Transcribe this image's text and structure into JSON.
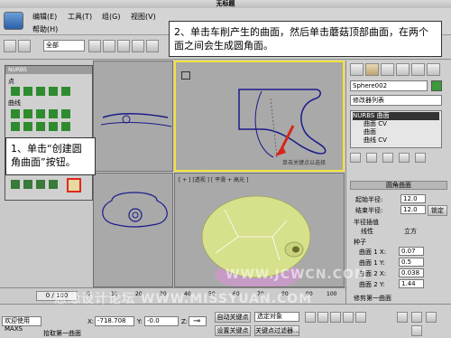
{
  "app": {
    "title": "无标题"
  },
  "menu": [
    "编辑(E)",
    "工具(T)",
    "组(G)",
    "视图(V)",
    "帮助(H)"
  ],
  "toolbar": {
    "selection_filter": "全部"
  },
  "callouts": {
    "step1": "1、单击“创建圆角曲面”按钮。",
    "step2": "2、单击车削产生的曲面，然后单击蘑菇顶部曲面，在两个面之间会生成圆角面。"
  },
  "nurbs_panel": {
    "title": "NURBS",
    "section_point": "点",
    "section_curve": "曲线"
  },
  "viewports": {
    "top_right_label": "",
    "bottom_right_label": "[ + ] [透视 ] [ 平滑 + 高光 ]",
    "hint": "单击关键点以选择"
  },
  "command_panel": {
    "object_name": "Sphere002",
    "modifier_list": "修改器列表",
    "stack": [
      "NURBS 曲面",
      "曲面 CV",
      "曲面",
      "曲线 CV"
    ],
    "rollout_title": "圆角曲面",
    "start_radius_label": "起始半径:",
    "start_radius": "12.0",
    "end_radius_label": "结束半径:",
    "end_radius": "12.0",
    "lock_label": "锁定",
    "radius_interp_label": "半径插值",
    "radius_interp_options": [
      "线性",
      "立方"
    ],
    "seed_label": "种子",
    "seed1_u_label": "曲面 1 X:",
    "seed1_u": "0.07",
    "seed1_v_label": "曲面 1 Y:",
    "seed1_v": "0.5",
    "seed2_u_label": "曲面 2 X:",
    "seed2_u": "0.038",
    "seed2_v_label": "曲面 2 Y:",
    "seed2_v": "1.44",
    "trim_label": "修剪第一曲面"
  },
  "timeline": {
    "frame_display": "0 / 100",
    "ticks": [
      "0",
      "10",
      "20",
      "30",
      "40",
      "50",
      "60",
      "70",
      "80",
      "90",
      "100"
    ]
  },
  "status": {
    "welcome": "欢迎使用 MAXS",
    "prompt": "拾取第一曲面",
    "x_label": "X:",
    "x_value": "-718.708",
    "y_label": "Y:",
    "y_value": "-0.0",
    "z_label": "Z:",
    "z_value": "",
    "auto_key": "自动关键点",
    "set_key": "设置关键点",
    "selected_object": "选定对象",
    "key_filter": "关键点过滤器..."
  },
  "watermarks": [
    "思缘设计论坛 WWW.MISSYUAN.COM",
    "WWW.JCWCN.COM"
  ],
  "colors": {
    "active_viewport": "#f1e23d",
    "callout_arrow": "#d8241b",
    "highlight_button": "#e0271c",
    "mushroom_yellow": "#d7e08b",
    "mushroom_pink": "#c69bc6"
  }
}
